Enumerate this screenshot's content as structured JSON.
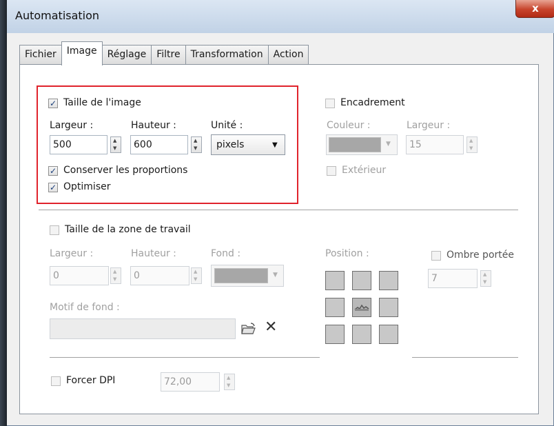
{
  "window": {
    "title": "Automatisation",
    "close_glyph": "x"
  },
  "tabs": [
    "Fichier",
    "Image",
    "Réglage",
    "Filtre",
    "Transformation",
    "Action"
  ],
  "image_size": {
    "checkbox_label": "Taille de l'image",
    "width_label": "Largeur :",
    "height_label": "Hauteur :",
    "unit_label": "Unité :",
    "width_value": "500",
    "height_value": "600",
    "unit_value": "pixels",
    "keep_ratio_label": "Conserver les proportions",
    "optimize_label": "Optimiser"
  },
  "frame": {
    "checkbox_label": "Encadrement",
    "color_label": "Couleur :",
    "width_label": "Largeur :",
    "width_value": "15",
    "outside_label": "Extérieur"
  },
  "workspace": {
    "checkbox_label": "Taille de la zone de travail",
    "width_label": "Largeur :",
    "height_label": "Hauteur :",
    "background_label": "Fond :",
    "width_value": "0",
    "height_value": "0",
    "position_label": "Position :",
    "pattern_label": "Motif de fond :",
    "shadow_label": "Ombre portée",
    "shadow_value": "7"
  },
  "dpi": {
    "checkbox_label": "Forcer DPI",
    "value": "72,00"
  },
  "checks": {
    "checked": "✓",
    "clear_icon": "✕"
  },
  "colors": {
    "highlight": "#e0222b",
    "swatch": "#a7a7a7"
  }
}
